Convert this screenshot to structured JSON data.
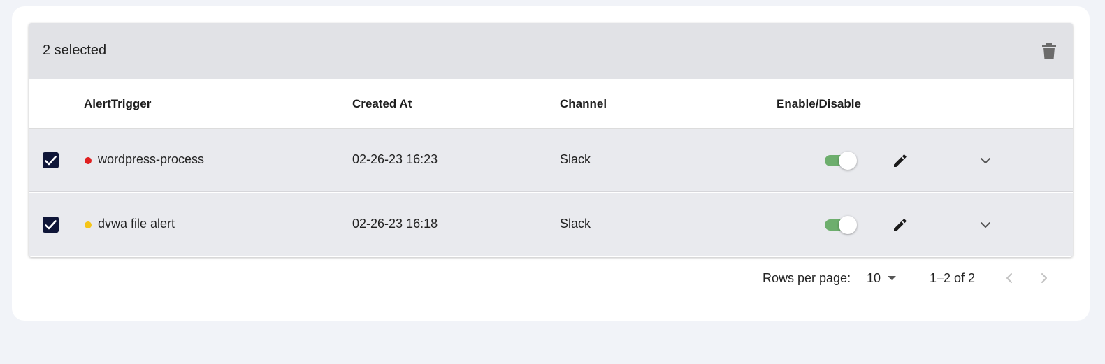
{
  "toolbar": {
    "selected_text": "2 selected",
    "delete_icon": "trash-icon"
  },
  "columns": {
    "trigger": "AlertTrigger",
    "created_at": "Created At",
    "channel": "Channel",
    "enable": "Enable/Disable"
  },
  "rows": [
    {
      "checked": true,
      "status_color": "#e02020",
      "name": "wordpress-process",
      "created_at": "02-26-23 16:23",
      "channel": "Slack",
      "enabled": true
    },
    {
      "checked": true,
      "status_color": "#f5c518",
      "name": "dvwa file alert",
      "created_at": "02-26-23 16:18",
      "channel": "Slack",
      "enabled": true
    }
  ],
  "pagination": {
    "rows_per_page_label": "Rows per page:",
    "rows_per_page_value": "10",
    "range_text": "1–2 of 2"
  },
  "colors": {
    "checkbox": "#0f1638",
    "toggle_on": "#6dae6d",
    "selection_bar": "#e1e2e6",
    "row_selected": "#e9eaee"
  }
}
